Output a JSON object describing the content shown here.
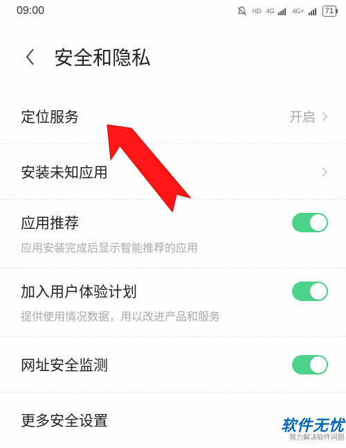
{
  "status": {
    "time": "09:00",
    "signal1_label": "HD",
    "signal2_label": "4G",
    "signal3_label": "4G+",
    "battery": "71"
  },
  "header": {
    "title": "安全和隐私"
  },
  "rows": {
    "location": {
      "label": "定位服务",
      "value": "开启"
    },
    "unknown": {
      "label": "安装未知应用"
    },
    "recommend": {
      "label": "应用推荐",
      "desc": "应用安装完成后显示智能推荐的应用"
    },
    "ux_plan": {
      "label": "加入用户体验计划",
      "desc": "提供使用情况数据，用以改进产品和服务"
    },
    "url_safe": {
      "label": "网址安全监测"
    },
    "more": {
      "label": "更多安全设置"
    }
  },
  "watermark": {
    "main": "软件无忧",
    "sub": "努力解决软件问题"
  }
}
